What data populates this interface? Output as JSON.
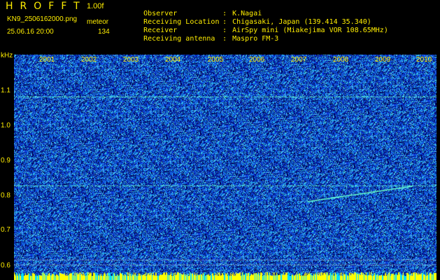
{
  "header": {
    "app_title": "HROFFT",
    "version": "1.00f",
    "filename": "KN9_2506162000.png",
    "meteor_label": "meteor",
    "datetime": "25.06.16 20:00",
    "meteor_count": "134"
  },
  "info": [
    {
      "label": "Observer",
      "sep": ":",
      "value": "K.Nagai"
    },
    {
      "label": "Receiving Location",
      "sep": ":",
      "value": "Chigasaki, Japan (139.414 35.340)"
    },
    {
      "label": "Receiver",
      "sep": ":",
      "value": "AirSpy mini (Miakejima VOR 108.65MHz)"
    },
    {
      "label": "Receiving antenna",
      "sep": ":",
      "value": "Maspro FM-3"
    }
  ],
  "spectrogram": {
    "y_unit": "kHz",
    "y_ticks": [
      "1.1",
      "1.0",
      "0.9",
      "0.8",
      "0.7",
      "0.6"
    ],
    "x_ticks": [
      "2001",
      "2002",
      "2003",
      "2004",
      "2005",
      "2006",
      "2007",
      "2008",
      "2009",
      "2010"
    ],
    "colors": {
      "background": "#1133cc",
      "noise_dark": "#000033",
      "noise_light": "#33ddee",
      "signal": "#66ffcc",
      "label": "#ffee00",
      "bottom_band": "#ffff00",
      "bottom_band_alt": "#00ddff"
    }
  }
}
